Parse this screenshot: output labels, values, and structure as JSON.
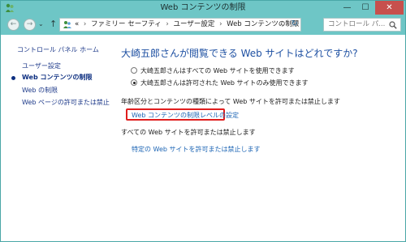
{
  "window": {
    "title": "Web コンテンツの制限",
    "buttons": {
      "minimize": "—",
      "maximize": "☐",
      "close": "✕"
    }
  },
  "address": {
    "back": "←",
    "forward": "→",
    "recent": "⌄",
    "up": "↑",
    "overflow": "«",
    "path": [
      "ファミリー セーフティ",
      "ユーザー設定",
      "Web コンテンツの制限"
    ],
    "separator": "›",
    "dropdown": "⌄",
    "refresh": "↻",
    "search_placeholder": "コントロール パ..."
  },
  "leftnav": {
    "home": "コントロール パネル ホーム",
    "items": [
      {
        "label": "ユーザー設定",
        "current": false
      },
      {
        "label": "Web コンテンツの制限",
        "current": true
      },
      {
        "label": "Web の制限",
        "current": false
      },
      {
        "label": "Web ページの許可または禁止",
        "current": false
      }
    ]
  },
  "main": {
    "heading": "大崎五郎さんが閲覧できる Web サイトはどれですか?",
    "options": [
      {
        "label": "大崎五郎さんはすべての Web サイトを使用できます",
        "checked": false
      },
      {
        "label": "大崎五郎さんは許可された Web サイトのみ使用できます",
        "checked": true
      }
    ],
    "rating_section": "年齢区分とコンテンツの種類によって Web サイトを許可または禁止します",
    "rating_link": "Web コンテンツの制限レベルの設定",
    "all_section": "すべての Web サイトを許可または禁止します",
    "all_link": "特定の Web サイトを許可または禁止します"
  },
  "colors": {
    "titlebar": "#6ec6c6",
    "close_button": "#c7504d",
    "link": "#1e66b5",
    "heading": "#1e50a2",
    "highlight": "#e01e1e"
  }
}
